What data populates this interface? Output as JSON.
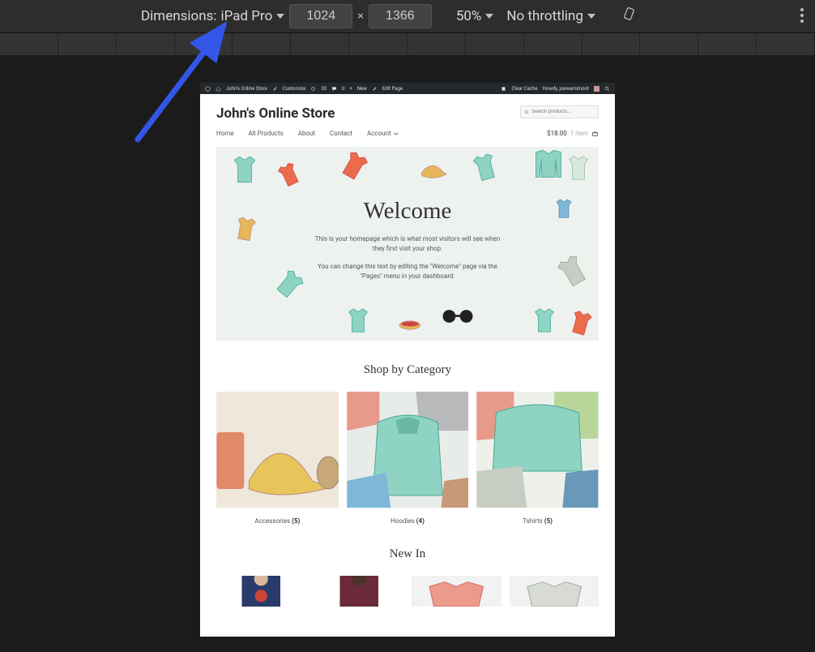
{
  "devtools": {
    "dimensions_label": "Dimensions:",
    "device": "iPad Pro",
    "width": "1024",
    "height": "1366",
    "zoom": "50%",
    "throttling": "No throttling"
  },
  "wp_admin": {
    "site_name": "John's Online Store",
    "customize": "Customize",
    "updates_count": "20",
    "comments_count": "0",
    "new_label": "New",
    "edit_label": "Edit Page",
    "clear_cache": "Clear Cache",
    "howdy": "Howdy, joewarnimont"
  },
  "site": {
    "title": "John's Online Store",
    "search_placeholder": "Search products…"
  },
  "nav": {
    "items": [
      "Home",
      "All Products",
      "About",
      "Contact",
      "Account"
    ],
    "cart_total": "$18.00",
    "cart_items": "1 item"
  },
  "hero": {
    "title": "Welcome",
    "line1": "This is your homepage which is what most visitors will see when they first visit your shop.",
    "line2": "You can change this text by editing the \"Welcome\" page via the \"Pages\" menu in your dashboard."
  },
  "shop_by_category": {
    "heading": "Shop by Category",
    "cats": [
      {
        "name": "Accessories",
        "count": "(5)"
      },
      {
        "name": "Hoodies",
        "count": "(4)"
      },
      {
        "name": "Tshirts",
        "count": "(5)"
      }
    ]
  },
  "new_in": {
    "heading": "New In"
  }
}
